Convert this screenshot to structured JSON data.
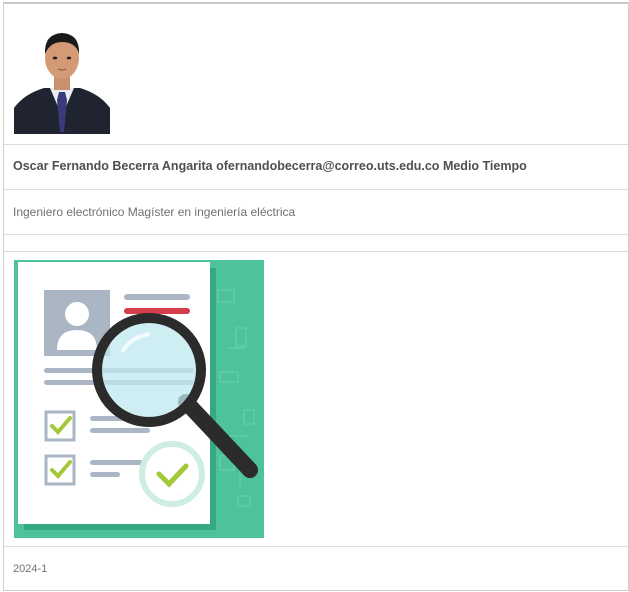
{
  "profile": {
    "name": "Oscar Fernando Becerra Angarita",
    "email": "ofernandobecerra@correo.uts.edu.co",
    "dedication": "Medio Tiempo",
    "description": "Ingeniero electrónico Magíster en ingeniería eléctrica",
    "period": "2024-1"
  },
  "colors": {
    "illustration_bg": "#4cc39a",
    "accent_red": "#d43d4a",
    "check_green": "#a3c93a"
  },
  "icons": {
    "photo": "profile-photo",
    "illustration": "resume-magnifier-illustration"
  }
}
